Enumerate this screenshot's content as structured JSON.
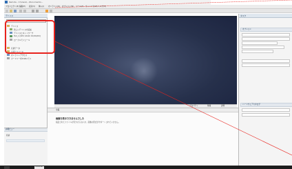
{
  "window": {
    "title": "Remote - C:\\Users\\...\\Documents\\..."
  },
  "menu": {
    "items": [
      "プロジェクト(P)",
      "編集(E)",
      "表示(V)",
      "挿入(I)",
      "オンライン(O)",
      "オプション(N)",
      "ツール(T)",
      "ウィンドウ(W)",
      "ヘルプ(H)"
    ]
  },
  "left_pane": {
    "title": "デバイス",
    "tree": [
      "デバイス",
      "新しいデバイスを追加",
      "デバイスとネットワーク",
      "PLC_1 [CPU 1214C DC/DC/DC]",
      "ローカルモジュール",
      "共通データ",
      "言語とリソース",
      "オンラインアクセス",
      "カードリーダ/USBメモリ"
    ],
    "details_title": "詳細ビュー",
    "details_label": "名前"
  },
  "viewer": {
    "status_items": [
      "プロパティ",
      "情報",
      "診断"
    ]
  },
  "bottom_panel": {
    "tab": "全般",
    "heading": "画像を表示できませんでした",
    "body": "指定されたファイルが見つからないか、画像の形式がサポートされていません。"
  },
  "right_pane": {
    "top_label": "タスク",
    "section1": "オプション",
    "section2": "ハードウェアカタログ"
  },
  "taskbar": {
    "item": "TIA Portal"
  },
  "colors": {
    "highlight": "#e8221c",
    "viewer_bg": "#25314f"
  }
}
